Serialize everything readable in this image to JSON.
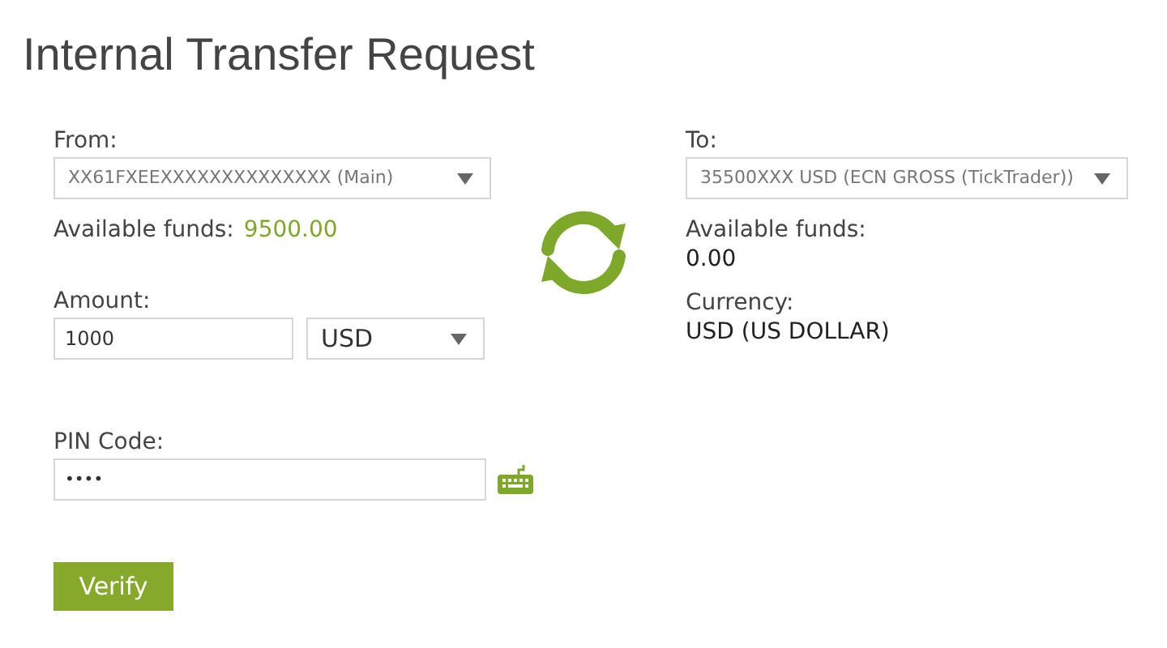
{
  "title": "Internal Transfer Request",
  "from": {
    "label": "From:",
    "value": "XX61FXEEXXXXXXXXXXXXXX (Main)",
    "funds_label": "Available funds:",
    "funds": "9500.00"
  },
  "amount": {
    "label": "Amount:",
    "value": "1000",
    "currency": "USD"
  },
  "to": {
    "label": "To:",
    "value": "35500XXX USD (ECN GROSS (TickTrader))",
    "funds_label": "Available funds:",
    "funds": "0.00",
    "currency_label": "Currency:",
    "currency": "USD (US DOLLAR)"
  },
  "pin": {
    "label": "PIN Code:",
    "value": "••••"
  },
  "button": "Verify"
}
